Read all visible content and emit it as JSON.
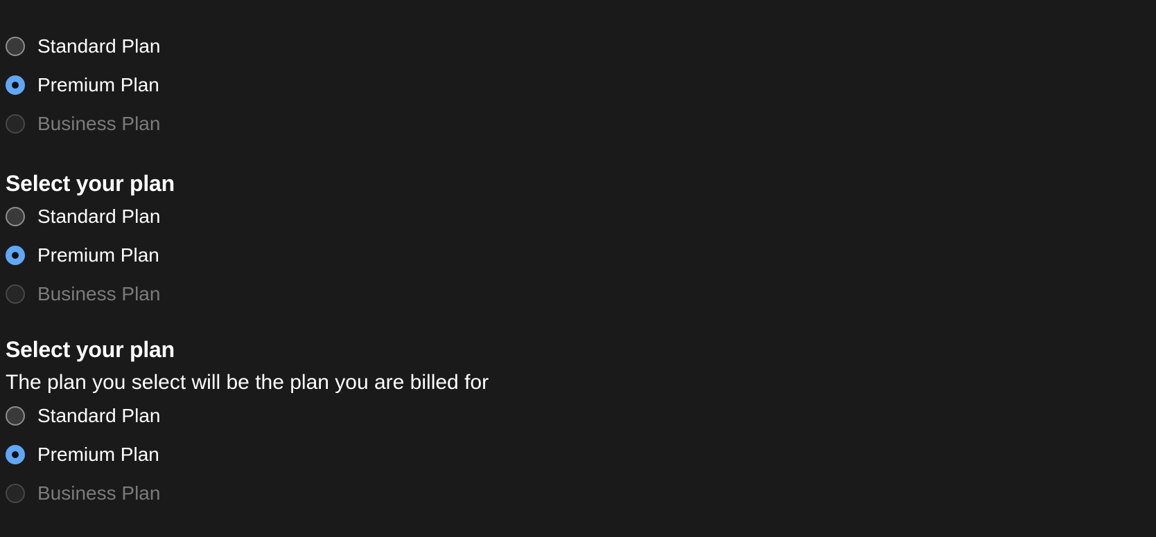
{
  "groups": [
    {
      "heading": "",
      "description": "",
      "options": [
        {
          "label": "Standard Plan",
          "state": "unchecked"
        },
        {
          "label": "Premium Plan",
          "state": "checked"
        },
        {
          "label": "Business Plan",
          "state": "disabled"
        }
      ]
    },
    {
      "heading": "Select your plan",
      "description": "",
      "options": [
        {
          "label": "Standard Plan",
          "state": "unchecked"
        },
        {
          "label": "Premium Plan",
          "state": "checked"
        },
        {
          "label": "Business Plan",
          "state": "disabled"
        }
      ]
    },
    {
      "heading": "Select your plan",
      "description": "The plan you select will be the plan you are billed for",
      "options": [
        {
          "label": "Standard Plan",
          "state": "unchecked"
        },
        {
          "label": "Premium Plan",
          "state": "checked"
        },
        {
          "label": "Business Plan",
          "state": "disabled"
        }
      ]
    }
  ],
  "colors": {
    "background": "#1a1a1a",
    "accent": "#60a8f6",
    "text": "#ffffff",
    "disabled_text": "#7b7b7b"
  }
}
